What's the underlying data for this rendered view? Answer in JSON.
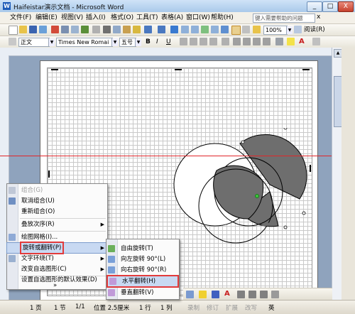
{
  "window": {
    "title": "Haifeistar演示文档 - Microsoft Word",
    "logo_letter": "W",
    "buttons": {
      "minimize": "_",
      "maximize": "□",
      "close": "X"
    }
  },
  "menubar": {
    "items": [
      "文件(F)",
      "编辑(E)",
      "视图(V)",
      "插入(I)",
      "格式(O)",
      "工具(T)",
      "表格(A)",
      "窗口(W)",
      "帮助(H)"
    ],
    "help_placeholder": "键入需要帮助的问题",
    "help_close": "x"
  },
  "standard_toolbar": {
    "zoom": "100%",
    "read_label": "阅读(R)"
  },
  "format_toolbar": {
    "style": "正文",
    "font": "Times New Romai",
    "size": "五号",
    "bold": "B",
    "italic": "I",
    "underline": "U",
    "font_color": "A"
  },
  "context_menu": {
    "items": [
      {
        "label": "组合(G)",
        "disabled": true,
        "icon": "group-icon"
      },
      {
        "label": "取消组合(U)",
        "disabled": false,
        "icon": "ungroup-icon"
      },
      {
        "label": "重新组合(O)",
        "disabled": false,
        "icon": ""
      },
      {
        "label": "叠放次序(R)",
        "disabled": false,
        "icon": "",
        "submenu": true
      },
      {
        "label": "绘图网格(I)...",
        "disabled": false,
        "icon": "grid-icon"
      },
      {
        "label": "旋转或翻转(P)",
        "disabled": false,
        "icon": "",
        "submenu": true,
        "highlighted": true
      },
      {
        "label": "文字环绕(T)",
        "disabled": false,
        "icon": "wrap-icon",
        "submenu": true
      },
      {
        "label": "改变自选图形(C)",
        "disabled": false,
        "icon": "",
        "submenu": true
      },
      {
        "label": "设置自选图形的默认效果(D)",
        "disabled": false,
        "icon": ""
      },
      {
        "label": "»",
        "disabled": false,
        "icon": ""
      }
    ]
  },
  "rotate_submenu": {
    "items": [
      {
        "label": "自由旋转(T)",
        "icon": "free-rotate-icon"
      },
      {
        "label": "向左旋转 90°(L)",
        "icon": "rotate-left-icon"
      },
      {
        "label": "向右旋转 90°(R)",
        "icon": "rotate-right-icon"
      },
      {
        "label": "水平翻转(H)",
        "icon": "flip-horizontal-icon",
        "highlighted": true
      },
      {
        "label": "垂直翻转(V)",
        "icon": "flip-vertical-icon"
      }
    ]
  },
  "drawing_toolbar": {
    "font_color": "A"
  },
  "status_bar": {
    "page": "1 页",
    "section": "1 节",
    "page_of": "1/1",
    "position": "位置 2.5厘米",
    "line": "1 行",
    "column": "1 列",
    "modes": [
      "录制",
      "修订",
      "扩展",
      "改写"
    ],
    "language": "英"
  },
  "colors": {
    "accent_red": "#e23b3b",
    "shape_gray": "#6e6e6e",
    "menu_highlight": "#c8d9f2"
  }
}
